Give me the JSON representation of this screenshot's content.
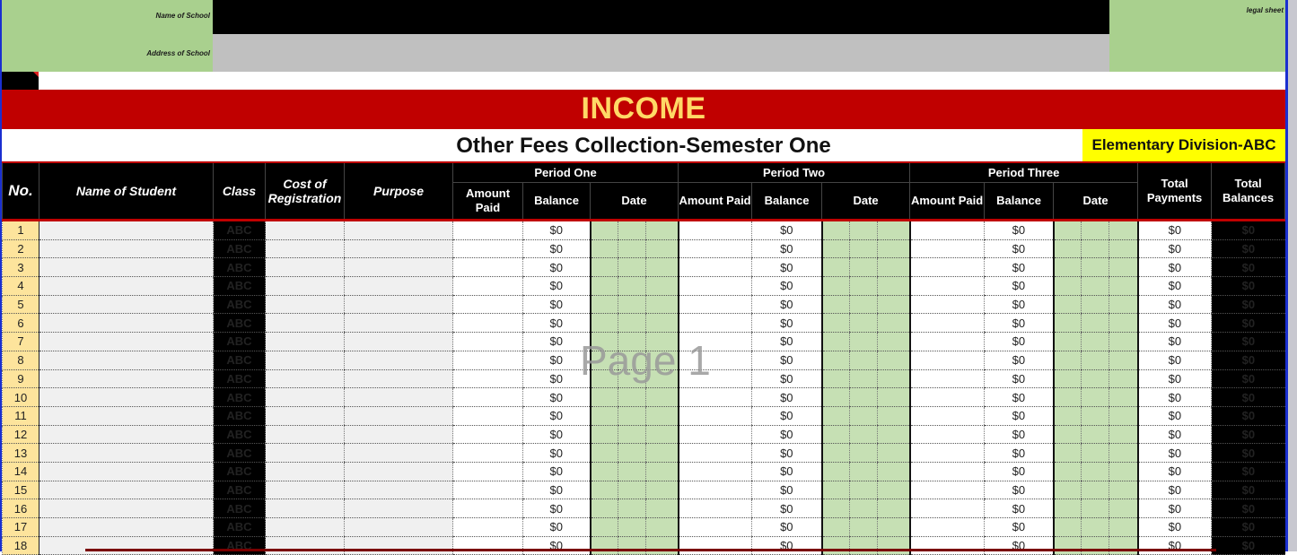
{
  "header": {
    "name_of_school_label": "Name of School",
    "address_of_school_label": "Address of School",
    "legal_sheet_label": "legal sheet",
    "name_of_school_value": "",
    "address_of_school_value": ""
  },
  "banner": {
    "title": "INCOME",
    "subtitle": "Other Fees Collection-Semester One",
    "division": "Elementary Division-ABC"
  },
  "colors": {
    "banner_red": "#c00000",
    "banner_text_gold": "#ffd966",
    "division_yellow": "#ffff00",
    "header_green": "#a9d08e",
    "date_green": "#c6e0b4",
    "row_number_tan": "#fde49c"
  },
  "table": {
    "columns": {
      "no": "No.",
      "name": "Name of Student",
      "class": "Class",
      "cost": "Cost of Registration",
      "purpose": "Purpose",
      "period_one": "Period One",
      "period_two": "Period Two",
      "period_three": "Period Three",
      "amount_paid": "Amount Paid",
      "balance": "Balance",
      "date": "Date",
      "total_payments": "Total Payments",
      "total_balances": "Total Balances"
    },
    "rows": [
      {
        "no": "1",
        "class": "ABC",
        "bal1": "$0",
        "bal2": "$0",
        "bal3": "$0",
        "tp": "$0",
        "tb": "$0"
      },
      {
        "no": "2",
        "class": "ABC",
        "bal1": "$0",
        "bal2": "$0",
        "bal3": "$0",
        "tp": "$0",
        "tb": "$0"
      },
      {
        "no": "3",
        "class": "ABC",
        "bal1": "$0",
        "bal2": "$0",
        "bal3": "$0",
        "tp": "$0",
        "tb": "$0"
      },
      {
        "no": "4",
        "class": "ABC",
        "bal1": "$0",
        "bal2": "$0",
        "bal3": "$0",
        "tp": "$0",
        "tb": "$0"
      },
      {
        "no": "5",
        "class": "ABC",
        "bal1": "$0",
        "bal2": "$0",
        "bal3": "$0",
        "tp": "$0",
        "tb": "$0"
      },
      {
        "no": "6",
        "class": "ABC",
        "bal1": "$0",
        "bal2": "$0",
        "bal3": "$0",
        "tp": "$0",
        "tb": "$0"
      },
      {
        "no": "7",
        "class": "ABC",
        "bal1": "$0",
        "bal2": "$0",
        "bal3": "$0",
        "tp": "$0",
        "tb": "$0"
      },
      {
        "no": "8",
        "class": "ABC",
        "bal1": "$0",
        "bal2": "$0",
        "bal3": "$0",
        "tp": "$0",
        "tb": "$0"
      },
      {
        "no": "9",
        "class": "ABC",
        "bal1": "$0",
        "bal2": "$0",
        "bal3": "$0",
        "tp": "$0",
        "tb": "$0"
      },
      {
        "no": "10",
        "class": "ABC",
        "bal1": "$0",
        "bal2": "$0",
        "bal3": "$0",
        "tp": "$0",
        "tb": "$0"
      },
      {
        "no": "11",
        "class": "ABC",
        "bal1": "$0",
        "bal2": "$0",
        "bal3": "$0",
        "tp": "$0",
        "tb": "$0"
      },
      {
        "no": "12",
        "class": "ABC",
        "bal1": "$0",
        "bal2": "$0",
        "bal3": "$0",
        "tp": "$0",
        "tb": "$0"
      },
      {
        "no": "13",
        "class": "ABC",
        "bal1": "$0",
        "bal2": "$0",
        "bal3": "$0",
        "tp": "$0",
        "tb": "$0"
      },
      {
        "no": "14",
        "class": "ABC",
        "bal1": "$0",
        "bal2": "$0",
        "bal3": "$0",
        "tp": "$0",
        "tb": "$0"
      },
      {
        "no": "15",
        "class": "ABC",
        "bal1": "$0",
        "bal2": "$0",
        "bal3": "$0",
        "tp": "$0",
        "tb": "$0"
      },
      {
        "no": "16",
        "class": "ABC",
        "bal1": "$0",
        "bal2": "$0",
        "bal3": "$0",
        "tp": "$0",
        "tb": "$0"
      },
      {
        "no": "17",
        "class": "ABC",
        "bal1": "$0",
        "bal2": "$0",
        "bal3": "$0",
        "tp": "$0",
        "tb": "$0"
      },
      {
        "no": "18",
        "class": "ABC",
        "bal1": "$0",
        "bal2": "$0",
        "bal3": "$0",
        "tp": "$0",
        "tb": "$0"
      }
    ]
  },
  "watermark": "Page 1"
}
